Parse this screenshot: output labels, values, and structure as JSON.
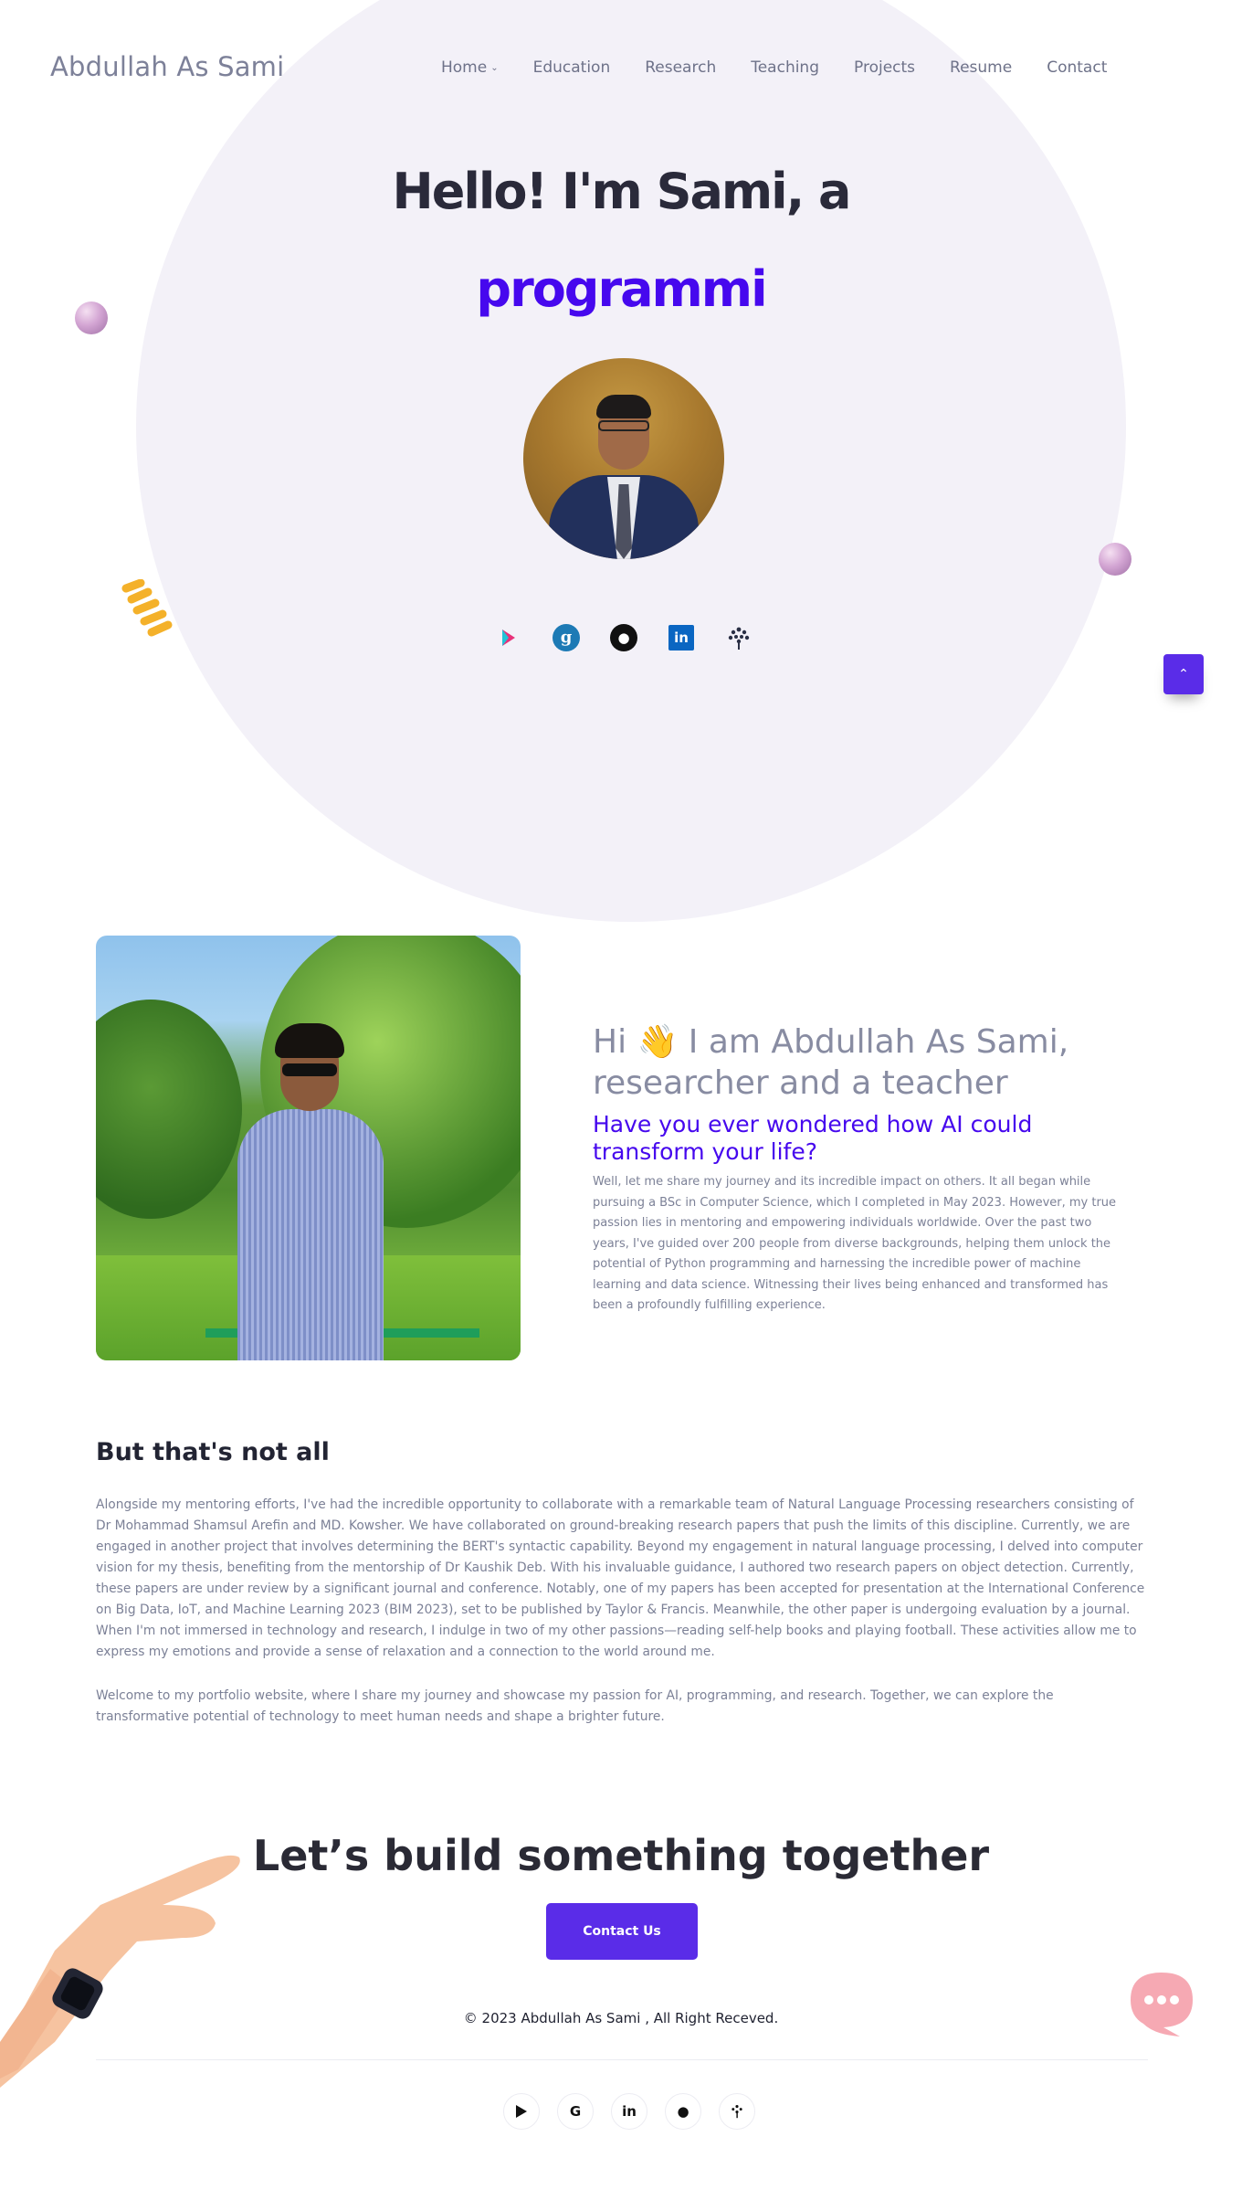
{
  "header": {
    "brand": "Abdullah As Sami",
    "nav": [
      "Home",
      "Education",
      "Research",
      "Teaching",
      "Projects",
      "Resume",
      "Contact"
    ]
  },
  "hero": {
    "title": "Hello! I'm Sami, a",
    "typed_text": "programmi",
    "accent_color": "#4608ee",
    "socials": [
      "play-icon",
      "google-scholar-icon",
      "github-icon",
      "linkedin-icon",
      "researchgate-icon"
    ],
    "social_glyphs": {
      "scholar": "g",
      "linkedin": "in"
    }
  },
  "about": {
    "greeting_prefix": "Hi",
    "wave": "👋",
    "greeting_rest": " I am Abdullah As Sami, researcher and a teacher",
    "question": "Have you ever wondered how AI could transform your life?",
    "body": "Well, let me share my journey and its incredible impact on others. It all began while pursuing a BSc in Computer Science, which I completed in May 2023. However, my true passion lies in mentoring and empowering individuals worldwide. Over the past two years, I've guided over 200 people from diverse backgrounds, helping them unlock the potential of Python programming and harnessing the incredible power of machine learning and data science. Witnessing their lives being enhanced and transformed has been a profoundly fulfilling experience."
  },
  "more": {
    "title": "But that's not all",
    "p1": "Alongside my mentoring efforts, I've had the incredible opportunity to collaborate with a remarkable team of Natural Language Processing researchers consisting of Dr Mohammad Shamsul Arefin and MD. Kowsher. We have collaborated on ground-breaking research papers that push the limits of this discipline. Currently, we are engaged in another project that involves determining the BERT's syntactic capability. Beyond my engagement in natural language processing, I delved into computer vision for my thesis, benefiting from the mentorship of Dr Kaushik Deb. With his invaluable guidance, I authored two research papers on object detection. Currently, these papers are under review by a significant journal and conference. Notably, one of my papers has been accepted for presentation at the International Conference on Big Data, IoT, and Machine Learning 2023 (BIM 2023), set to be published by Taylor & Francis. Meanwhile, the other paper is undergoing evaluation by a journal. When I'm not immersed in technology and research, I indulge in two of my other passions—reading self-help books and playing football. These activities allow me to express my emotions and provide a sense of relaxation and a connection to the world around me.",
    "p2": "Welcome to my portfolio website, where I share my journey and showcase my passion for AI, programming, and research. Together, we can explore the transformative potential of technology to meet human needs and shape a brighter future."
  },
  "cta": {
    "title": "Let’s build something together",
    "button": "Contact Us",
    "button_color": "#5a2ce8"
  },
  "footer": {
    "copyright": "© 2023 Abdullah As Sami , All Right Receved.",
    "socials": [
      "play-icon",
      "google-icon",
      "linkedin-icon",
      "github-icon",
      "researchgate-icon"
    ],
    "glyphs": {
      "google": "G",
      "linkedin": "in"
    }
  },
  "colors": {
    "hero_bg": "#f3f1f8",
    "text_muted": "#7c8197"
  }
}
